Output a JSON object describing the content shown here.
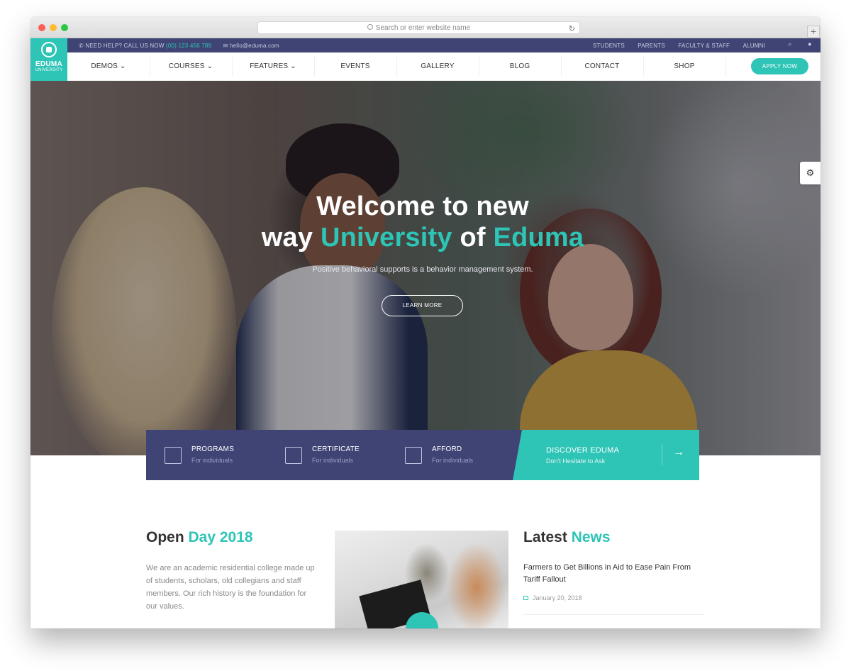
{
  "browser": {
    "url_placeholder": "Search or enter website name",
    "reload_icon": "reload-icon",
    "new_tab": "+"
  },
  "topbar": {
    "help_prefix": "NEED HELP? CALL US NOW",
    "phone": "(00) 123 456 789",
    "email": "hello@eduma.com",
    "links": [
      "STUDENTS",
      "PARENTS",
      "FACULTY & STAFF",
      "ALUMNI"
    ]
  },
  "logo": {
    "name": "EDUMA",
    "sub": "UNIVERSITY"
  },
  "nav": {
    "items": [
      {
        "label": "DEMOS",
        "dropdown": "⌄"
      },
      {
        "label": "COURSES",
        "dropdown": "⌄"
      },
      {
        "label": "FEATURES",
        "dropdown": "⌄"
      },
      {
        "label": "EVENTS"
      },
      {
        "label": "GALLERY"
      },
      {
        "label": "BLOG"
      },
      {
        "label": "CONTACT"
      },
      {
        "label": "SHOP"
      }
    ],
    "cta": "APPLY NOW"
  },
  "hero": {
    "line1": "Welcome to new",
    "line2_pre": "way",
    "line2_accent1": "University",
    "line2_mid": "of",
    "line2_accent2": "Eduma",
    "lead": "Positive behavioral supports is a behavior management system.",
    "button": "LEARN MORE"
  },
  "features": [
    {
      "title": "PROGRAMS",
      "sub": "For individuals",
      "icon": "map-pin-icon"
    },
    {
      "title": "CERTIFICATE",
      "sub": "For individuals",
      "icon": "clipboard-icon"
    },
    {
      "title": "AFFORD",
      "sub": "For individuals",
      "icon": "map-icon"
    }
  ],
  "discover": {
    "title": "DISCOVER EDUMA",
    "sub": "Don't Hesitate to Ask",
    "arrow": "→"
  },
  "openday": {
    "title_pre": "Open",
    "title_accent": "Day 2018",
    "text": "We are an academic residential college made up of students, scholars, old collegians and staff members. Our rich history is the foundation for our values."
  },
  "news": {
    "title_pre": "Latest",
    "title_accent": "News",
    "item_title": "Farmers to Get Billions in Aid to Ease Pain From Tariff Fallout",
    "item_date": "January 20, 2018"
  },
  "colors": {
    "accent": "#2ec4b6",
    "navy": "#3f4474"
  }
}
